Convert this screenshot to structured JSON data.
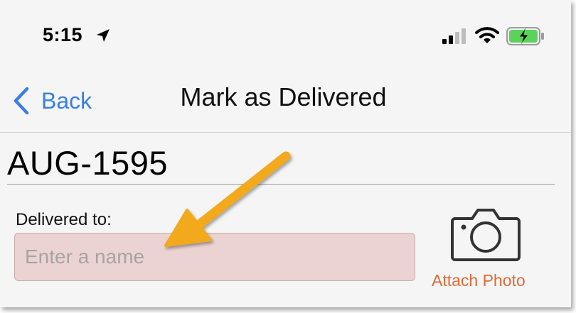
{
  "status_bar": {
    "time": "5:15",
    "icons": [
      "location-arrow-icon",
      "cellular-signal-icon",
      "wifi-icon",
      "battery-charging-icon"
    ]
  },
  "nav": {
    "back_label": "Back",
    "title": "Mark as Delivered"
  },
  "order": {
    "id": "AUG-1595"
  },
  "delivery": {
    "label": "Delivered to:",
    "name_value": "",
    "name_placeholder": "Enter a name"
  },
  "attach": {
    "label": "Attach Photo",
    "icon": "camera-icon"
  },
  "colors": {
    "accent_blue": "#3a7fe0",
    "attach_orange": "#dd6a3a",
    "field_error_bg": "#ecd3d3",
    "battery_green": "#5bd35b",
    "annotation_arrow": "#f2a91e"
  }
}
